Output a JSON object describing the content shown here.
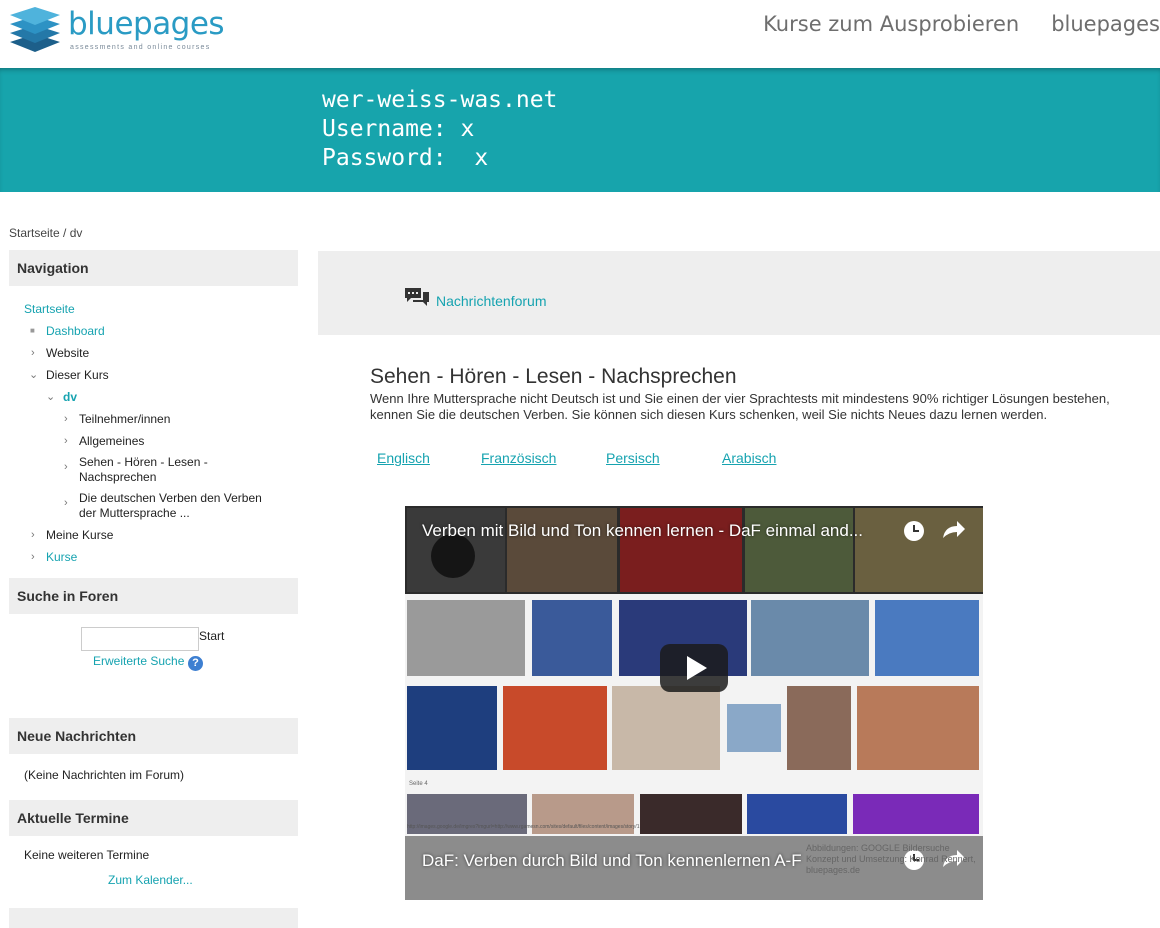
{
  "header": {
    "logo_text": "bluepages",
    "logo_tagline": "assessments and online courses",
    "nav": [
      "Kurse zum Ausprobieren",
      "bluepages"
    ]
  },
  "banner": {
    "line1": "wer-weiss-was.net",
    "line2": "Username: x",
    "line3": "Password:  x"
  },
  "breadcrumb": [
    "Startseite",
    "dv"
  ],
  "sidebar": {
    "navigation": {
      "title": "Navigation",
      "startseite": "Startseite",
      "dashboard": "Dashboard",
      "website": "Website",
      "dieser_kurs": "Dieser Kurs",
      "dv": "dv",
      "teilnehmer": "Teilnehmer/innen",
      "allgemeines": "Allgemeines",
      "sehen": "Sehen - Hören - Lesen - Nachsprechen",
      "verben": "Die deutschen Verben den Verben der Muttersprache ...",
      "meine_kurse": "Meine Kurse",
      "kurse": "Kurse"
    },
    "suche": {
      "title": "Suche in Foren",
      "button": "Start",
      "advanced": "Erweiterte Suche",
      "help_glyph": "?"
    },
    "nachrichten": {
      "title": "Neue Nachrichten",
      "empty": "(Keine Nachrichten im Forum)"
    },
    "termine": {
      "title": "Aktuelle Termine",
      "empty": "Keine weiteren Termine",
      "link": "Zum Kalender..."
    }
  },
  "main": {
    "forum_link": "Nachrichtenforum",
    "section_title": "Sehen - Hören - Lesen - Nachsprechen",
    "section_desc": "Wenn Ihre Muttersprache nicht Deutsch ist und Sie einen der vier Sprachtests mit mindestens 90% richtiger Lösungen bestehen, kennen Sie die deutschen Verben. Sie können sich diesen Kurs schenken, weil Sie nichts Neues dazu lernen werden.",
    "languages": [
      "Englisch",
      "Französisch",
      "Persisch",
      "Arabisch"
    ],
    "video": {
      "title": "Verben mit Bild und Ton kennen lernen - DaF einmal and...",
      "title2": "DaF: Verben durch Bild und Ton kennenlernen A-F",
      "page_label": "Seite 4",
      "url_text": "http://images.google.de/imgres?imgurl=http://www.rgamesn.com/sites/default/files/content/images/story/1",
      "attribution": "Abbildungen: GOOGLE Bildersuche Konzept und Umsetzung: Konrad Rennert, bluepages.de"
    }
  },
  "colors": {
    "brand_teal": "#17a4ac",
    "link_teal": "#16a3b0",
    "logo_blue": "#2a9bc4"
  }
}
